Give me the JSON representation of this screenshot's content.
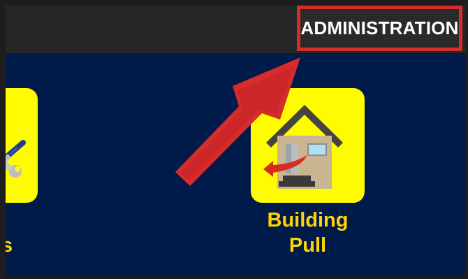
{
  "header": {
    "admin_label": "ADMINISTRATION"
  },
  "tiles": [
    {
      "id": "left",
      "label": "s",
      "icon": "wrench-screwdriver-icon"
    },
    {
      "id": "building",
      "label_line1": "Building",
      "label_line2": "Pull",
      "icon": "house-icon"
    }
  ],
  "colors": {
    "topbar": "#262626",
    "background": "#001a4a",
    "tile": "#fffb00",
    "label": "#ffd400",
    "highlight": "#d72c2c"
  },
  "annotation": {
    "icon": "red-arrow-icon"
  }
}
